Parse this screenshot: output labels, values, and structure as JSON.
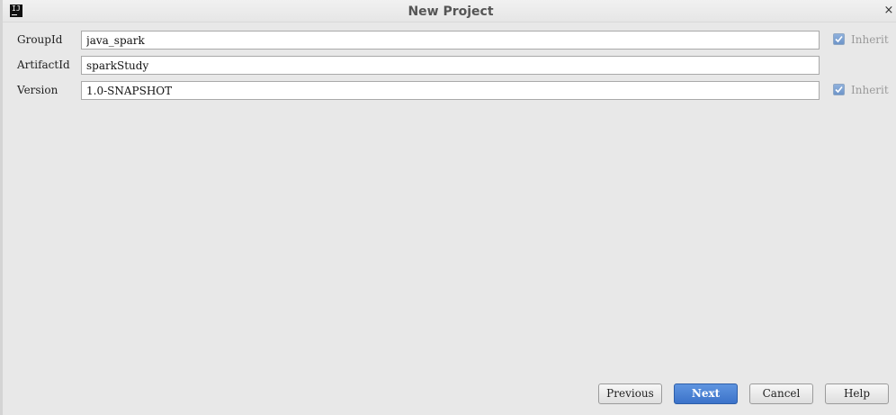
{
  "window": {
    "title": "New Project",
    "app_icon_text": "IJ",
    "close_glyph": "×"
  },
  "form": {
    "group_id": {
      "label": "GroupId",
      "value": "java_spark",
      "inherit": {
        "checked": true,
        "label": "Inherit"
      }
    },
    "artifact_id": {
      "label": "ArtifactId",
      "value": "sparkStudy"
    },
    "version": {
      "label": "Version",
      "value": "1.0-SNAPSHOT",
      "inherit": {
        "checked": true,
        "label": "Inherit"
      }
    }
  },
  "buttons": {
    "previous": "Previous",
    "next": "Next",
    "cancel": "Cancel",
    "help": "Help"
  },
  "colors": {
    "dialog_background": "#e8e8e8",
    "primary_button": "#4a82d6",
    "checkbox": "#7aa0d4"
  },
  "icons": {
    "app": "intellij-idea-icon",
    "close": "close-icon",
    "checkbox": "checkmark-icon"
  }
}
